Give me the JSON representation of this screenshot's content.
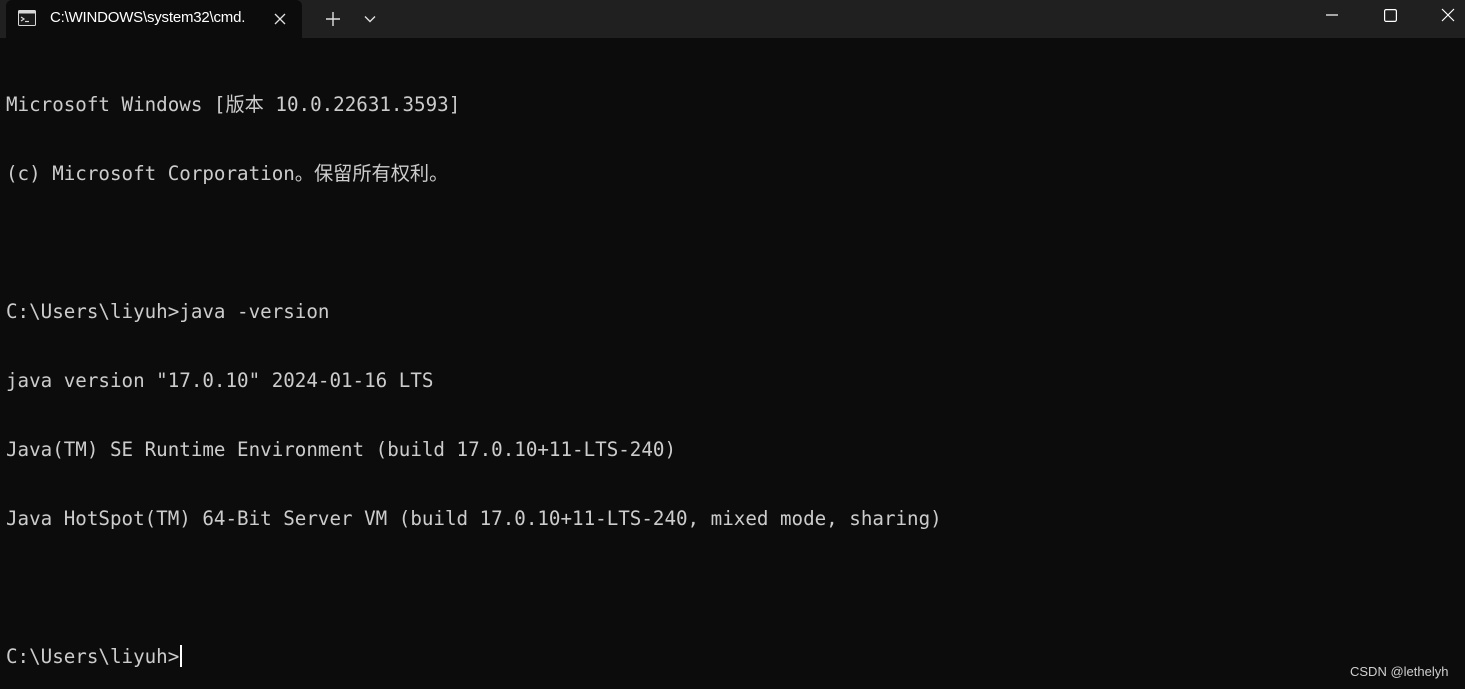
{
  "titlebar": {
    "tab_title": "C:\\WINDOWS\\system32\\cmd.",
    "tab_icon": "terminal-icon",
    "close_icon": "close-icon",
    "new_tab_icon": "plus-icon",
    "dropdown_icon": "chevron-down-icon",
    "window_controls": [
      "minimize-icon",
      "maximize-icon",
      "close-icon"
    ]
  },
  "console": {
    "lines": [
      "Microsoft Windows [版本 10.0.22631.3593]",
      "(c) Microsoft Corporation。保留所有权利。",
      "",
      "C:\\Users\\liyuh>java -version",
      "java version \"17.0.10\" 2024-01-16 LTS",
      "Java(TM) SE Runtime Environment (build 17.0.10+11-LTS-240)",
      "Java HotSpot(TM) 64-Bit Server VM (build 17.0.10+11-LTS-240, mixed mode, sharing)",
      "",
      "C:\\Users\\liyuh>"
    ]
  },
  "watermark": "CSDN @lethelyh",
  "colors": {
    "titlebar_bg": "#202020",
    "console_bg": "#0c0c0c",
    "console_text": "#cccccc"
  }
}
